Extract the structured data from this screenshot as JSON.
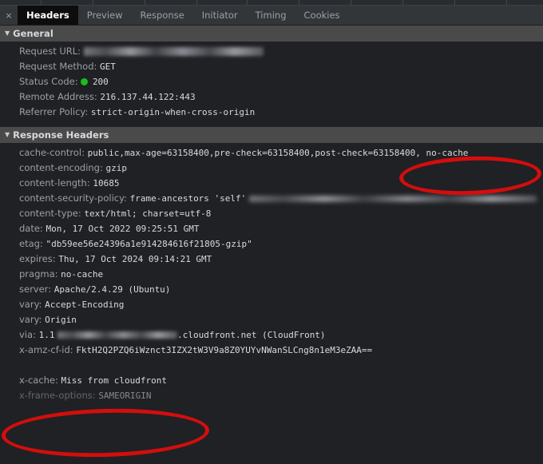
{
  "tabbar": {
    "close_label": "×",
    "tabs": [
      {
        "label": "Headers",
        "active": true
      },
      {
        "label": "Preview",
        "active": false
      },
      {
        "label": "Response",
        "active": false
      },
      {
        "label": "Initiator",
        "active": false
      },
      {
        "label": "Timing",
        "active": false
      },
      {
        "label": "Cookies",
        "active": false
      }
    ]
  },
  "sections": {
    "general": {
      "title": "General",
      "twisty": "▼",
      "rows": [
        {
          "key": "Request URL:",
          "value": "",
          "redacted": true
        },
        {
          "key": "Request Method:",
          "value": "GET"
        },
        {
          "key": "Status Code:",
          "value": "200",
          "status_dot": true
        },
        {
          "key": "Remote Address:",
          "value": "216.137.44.122:443"
        },
        {
          "key": "Referrer Policy:",
          "value": "strict-origin-when-cross-origin"
        }
      ]
    },
    "response_headers": {
      "title": "Response Headers",
      "twisty": "▼",
      "rows": [
        {
          "key": "cache-control:",
          "value": "public,max-age=63158400,pre-check=63158400,post-check=63158400, no-cache"
        },
        {
          "key": "content-encoding:",
          "value": "gzip"
        },
        {
          "key": "content-length:",
          "value": "10685"
        },
        {
          "key": "content-security-policy:",
          "value": "frame-ancestors 'self'",
          "redacted_tail": true
        },
        {
          "key": "content-type:",
          "value": "text/html; charset=utf-8"
        },
        {
          "key": "date:",
          "value": "Mon, 17 Oct 2022 09:25:51 GMT"
        },
        {
          "key": "etag:",
          "value": "\"db59ee56e24396a1e914284616f21805-gzip\""
        },
        {
          "key": "expires:",
          "value": "Thu, 17 Oct 2024 09:14:21 GMT"
        },
        {
          "key": "pragma:",
          "value": "no-cache"
        },
        {
          "key": "server:",
          "value": "Apache/2.4.29 (Ubuntu)"
        },
        {
          "key": "vary:",
          "value": "Accept-Encoding"
        },
        {
          "key": "vary:",
          "value": "Origin"
        },
        {
          "key": "via:",
          "value": "1.1",
          "value_tail": ".cloudfront.net (CloudFront)",
          "redacted_mid": true
        },
        {
          "key": "x-amz-cf-id:",
          "value": "FktH2Q2PZQ6iWznct3IZX2tW3V9a8Z0YUYvNWanSLCng8n1eM3eZAA=="
        },
        {
          "key": "x-cache:",
          "value": "Miss from cloudfront"
        },
        {
          "key": "x-frame-options:",
          "value": "SAMEORIGIN",
          "obscured": true
        }
      ]
    }
  },
  "annotations": {
    "cache_control_highlight": "0, no-cache",
    "xcache_highlight": "x-cache: Miss from cloudfront",
    "color": "#d40d0d"
  }
}
